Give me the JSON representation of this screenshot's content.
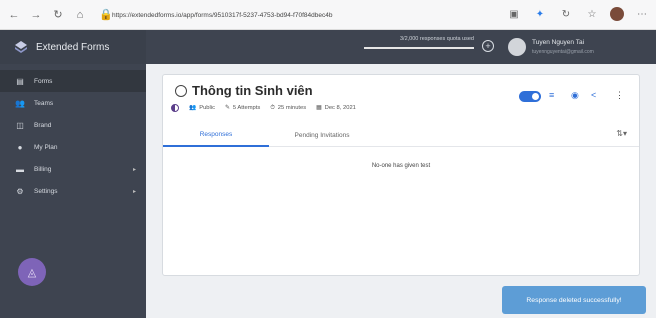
{
  "browser": {
    "url": "https://extendedforms.io/app/forms/9510317f-5237-4753-bd94-f70f84dbec4b",
    "icons": [
      "back-icon",
      "forward-icon",
      "reload-icon",
      "home-icon",
      "lock-icon",
      "tab-search-icon",
      "extension-icon",
      "refresh-icon",
      "favorites-icon",
      "profile-icon",
      "more-icon"
    ]
  },
  "app": {
    "brand": "Extended Forms",
    "quota_text": "3/2,000 responses quota used",
    "user_name": "Tuyen Nguyen Tai",
    "user_email": "tuyennguyentai@gmail.com"
  },
  "sidebar": {
    "items": [
      {
        "label": "Forms",
        "icon": "forms-icon",
        "active": true
      },
      {
        "label": "Teams",
        "icon": "teams-icon"
      },
      {
        "label": "Brand",
        "icon": "brand-icon"
      },
      {
        "label": "My Plan",
        "icon": "plan-icon"
      },
      {
        "label": "Billing",
        "icon": "billing-icon",
        "caret": "▸"
      },
      {
        "label": "Settings",
        "icon": "settings-icon",
        "caret": "▸"
      }
    ]
  },
  "form": {
    "title": "Thông tin Sinh viên",
    "visibility": "Public",
    "attempts": "5 Attempts",
    "duration": "25 minutes",
    "date": "Dec 8, 2021"
  },
  "tabs": [
    {
      "label": "Responses",
      "active": true
    },
    {
      "label": "Pending Invitations"
    }
  ],
  "empty_message": "No-one has given test",
  "toast": "Response deleted successfully!",
  "colors": {
    "sidebar_bg": "#3e4450",
    "accent": "#2f6fd8",
    "toast_bg": "#5d9dd6",
    "fab": "#7e64b8"
  }
}
